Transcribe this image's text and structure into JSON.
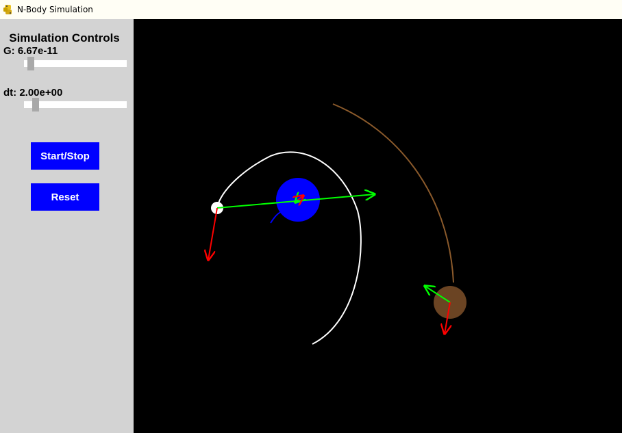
{
  "window": {
    "title": "N-Body Simulation",
    "icon": "python-logo-icon"
  },
  "sidebar": {
    "title": "Simulation Controls",
    "g_slider": {
      "label": "G: 6.67e-11"
    },
    "dt_slider": {
      "label": "dt: 2.00e+00"
    },
    "start_stop_label": "Start/Stop",
    "reset_label": "Reset"
  },
  "simulation": {
    "bodies": [
      {
        "name": "white-body",
        "color": "#ffffff"
      },
      {
        "name": "blue-body",
        "color": "#0000ff"
      },
      {
        "name": "brown-body",
        "color": "#6b4423"
      }
    ],
    "velocity_vector_color": "#00ff00",
    "force_vector_color": "#ff0000",
    "trail_colors": {
      "white": "#ffffff",
      "blue": "#0000ff",
      "brown": "#8b5a2b"
    }
  }
}
